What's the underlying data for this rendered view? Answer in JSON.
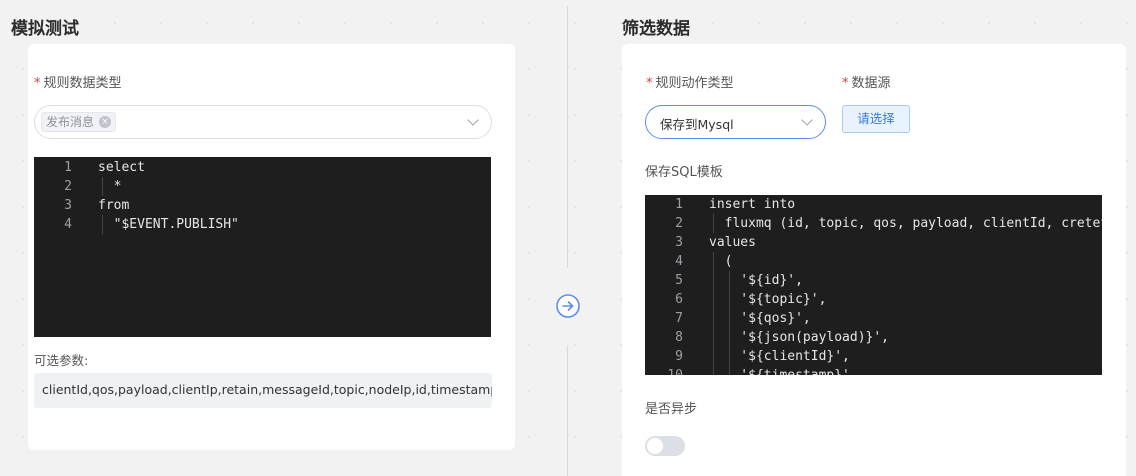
{
  "left": {
    "title": "模拟测试",
    "rule_type_label": "规则数据类型",
    "required_mark": "*",
    "selected_tag": "发布消息",
    "code_lines": [
      {
        "n": "1",
        "t": "select"
      },
      {
        "n": "2",
        "t": "  *"
      },
      {
        "n": "3",
        "t": "from"
      },
      {
        "n": "4",
        "t": "  \"$EVENT.PUBLISH\""
      }
    ],
    "params_label": "可选参数:",
    "params_value": "clientId,qos,payload,clientIp,retain,messageId,topic,nodeIp,id,timestamp"
  },
  "right": {
    "title": "筛选数据",
    "action_type_label": "规则动作类型",
    "datasource_label": "数据源",
    "required_mark": "*",
    "action_selected": "保存到Mysql",
    "choose_button": "请选择",
    "sql_label": "保存SQL模板",
    "sql_lines": [
      {
        "n": "1",
        "t": "insert into"
      },
      {
        "n": "2",
        "t": "  fluxmq (id, topic, qos, payload, clientId, cretet"
      },
      {
        "n": "3",
        "t": "values"
      },
      {
        "n": "4",
        "t": "  ("
      },
      {
        "n": "5",
        "t": "    '${id}',"
      },
      {
        "n": "6",
        "t": "    '${topic}',"
      },
      {
        "n": "7",
        "t": "    '${qos}',"
      },
      {
        "n": "8",
        "t": "    '${json(payload)}',"
      },
      {
        "n": "9",
        "t": "    '${clientId}',"
      },
      {
        "n": "10",
        "t": "    '${timestamp}',"
      }
    ],
    "async_label": "是否异步",
    "async_enabled": false
  },
  "colors": {
    "accent": "#3a7bd5",
    "required": "#e4393c",
    "code_bg": "#1e1e1e"
  }
}
